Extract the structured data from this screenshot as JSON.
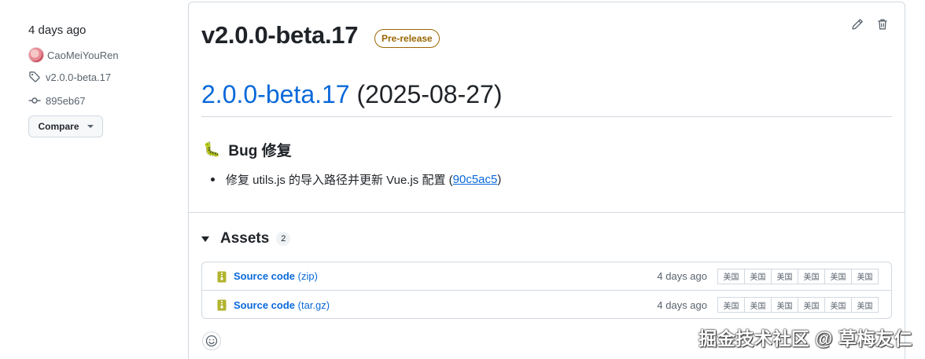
{
  "sidebar": {
    "date": "4 days ago",
    "author": "CaoMeiYouRen",
    "tag": "v2.0.0-beta.17",
    "commit": "895eb67",
    "compare_label": "Compare"
  },
  "release": {
    "title": "v2.0.0-beta.17",
    "badge": "Pre-release",
    "heading_link": "2.0.0-beta.17",
    "heading_rest": " (2025-08-27)",
    "section_emoji": "🐛",
    "section_title": "Bug 修复",
    "bullet_text": "修复 utils.js 的导入路径并更新 Vue.js 配置 (",
    "bullet_link": "90c5ac5",
    "bullet_close": ")"
  },
  "assets": {
    "label": "Assets",
    "count": "2",
    "items": [
      {
        "name": "Source code",
        "ext": "(zip)",
        "time": "4 days ago",
        "mirrors": [
          "美国",
          "美国",
          "美国",
          "美国",
          "美国",
          "美国"
        ]
      },
      {
        "name": "Source code",
        "ext": "(tar.gz)",
        "time": "4 days ago",
        "mirrors": [
          "美国",
          "美国",
          "美国",
          "美国",
          "美国",
          "美国"
        ]
      }
    ]
  },
  "watermark": "掘金技术社区 @ 草梅友仁",
  "colors": {
    "link": "#0969da",
    "prerelease": "#9a6700",
    "border": "#d1d9e0",
    "muted": "#59636e"
  }
}
